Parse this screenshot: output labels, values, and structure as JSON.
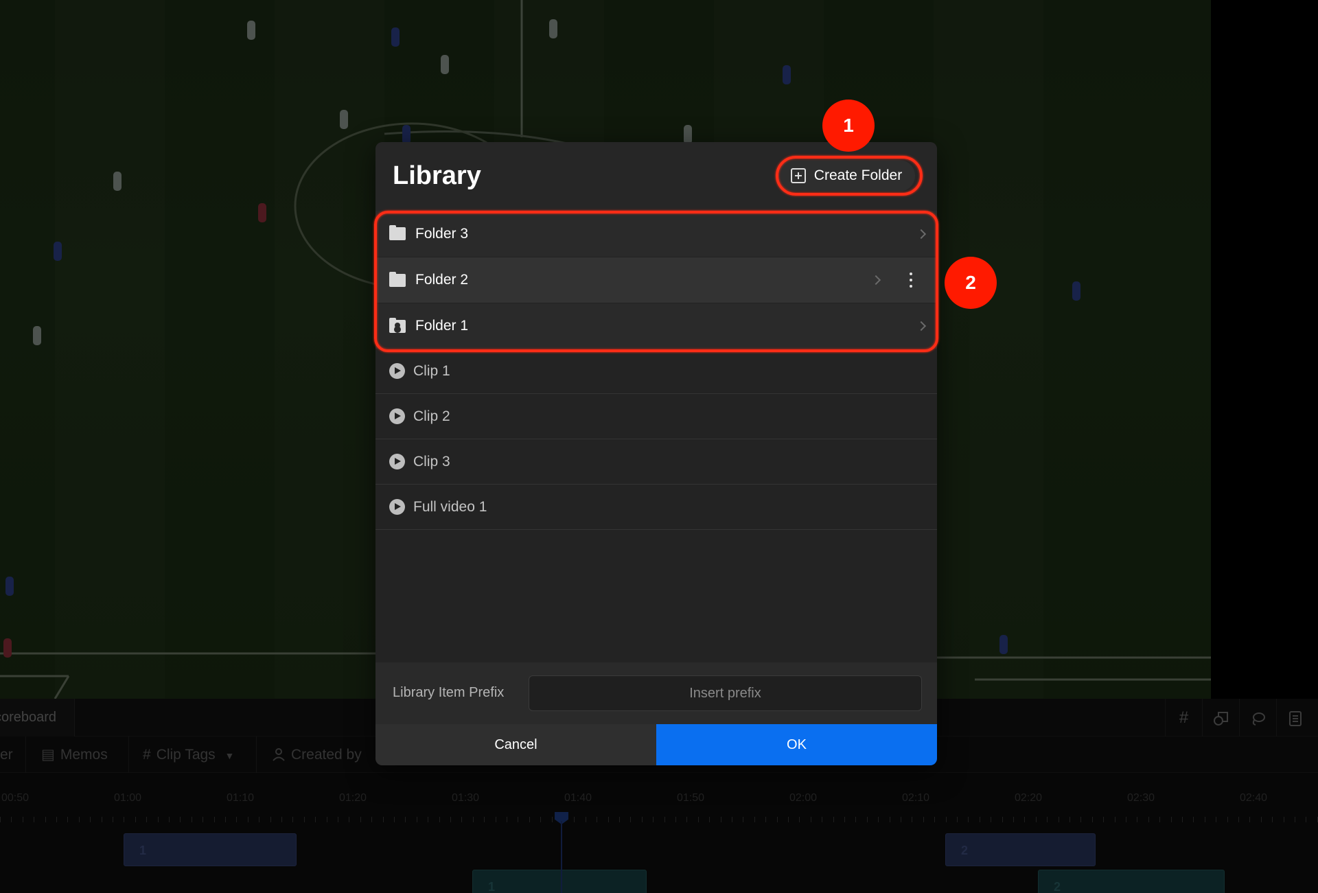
{
  "dialog": {
    "title": "Library",
    "create_folder_label": "Create Folder",
    "folders": [
      {
        "label": "Folder 3"
      },
      {
        "label": "Folder 2"
      },
      {
        "label": "Folder 1"
      }
    ],
    "clips": [
      {
        "label": "Clip 1"
      },
      {
        "label": "Clip 2"
      },
      {
        "label": "Clip 3"
      },
      {
        "label": "Full video 1"
      }
    ],
    "prefix_label": "Library Item Prefix",
    "prefix_placeholder": "Insert prefix",
    "prefix_value": "",
    "cancel_label": "Cancel",
    "ok_label": "OK"
  },
  "annotations": {
    "badge_1": "1",
    "badge_2": "2"
  },
  "bottom": {
    "scoreboard_tab": "coreboard",
    "filters": {
      "partial": "er",
      "memos": "Memos",
      "clip_tags": "Clip Tags",
      "created_by": "Created by"
    },
    "tool_icons": [
      "hash-icon",
      "shapes-icon",
      "lasso-icon",
      "notes-icon"
    ]
  },
  "timeline": {
    "ticks": [
      "00:50",
      "01:00",
      "01:10",
      "01:20",
      "01:30",
      "01:40",
      "01:50",
      "02:00",
      "02:10",
      "02:20",
      "02:30",
      "02:40"
    ],
    "clips": [
      {
        "label": "1",
        "track": "blue"
      },
      {
        "label": "2",
        "track": "blue"
      },
      {
        "label": "1",
        "track": "teal"
      },
      {
        "label": "2",
        "track": "teal"
      }
    ]
  },
  "colors": {
    "accent": "#0a6ff0",
    "annotation": "#ff1a00",
    "dialog_bg": "#232323"
  }
}
